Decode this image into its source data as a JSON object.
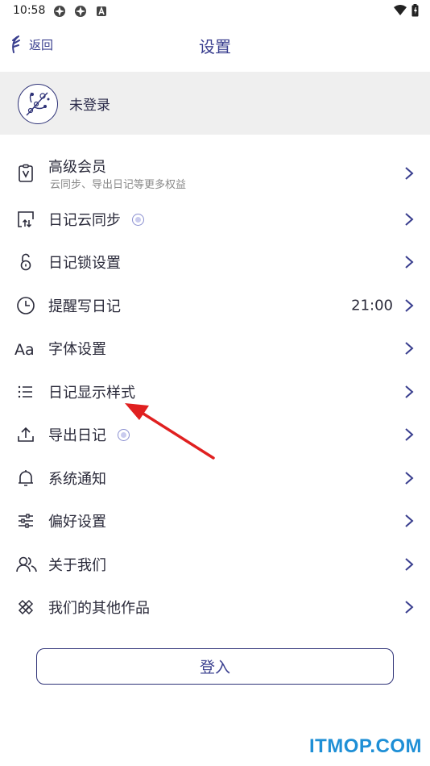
{
  "status_bar": {
    "time": "10:58"
  },
  "header": {
    "back_label": "返回",
    "title": "设置"
  },
  "account": {
    "label": "未登录"
  },
  "menu": [
    {
      "icon": "vip-clipboard-icon",
      "label": "高级会员",
      "sub": "云同步、导出日记等更多权益"
    },
    {
      "icon": "cloud-sync-icon",
      "label": "日记云同步",
      "badge": true
    },
    {
      "icon": "lock-icon",
      "label": "日记锁设置"
    },
    {
      "icon": "clock-icon",
      "label": "提醒写日记",
      "value": "21:00"
    },
    {
      "icon": "font-icon",
      "label": "字体设置"
    },
    {
      "icon": "list-icon",
      "label": "日记显示样式"
    },
    {
      "icon": "export-icon",
      "label": "导出日记",
      "badge": true
    },
    {
      "icon": "bell-icon",
      "label": "系统通知"
    },
    {
      "icon": "sliders-icon",
      "label": "偏好设置"
    },
    {
      "icon": "users-icon",
      "label": "关于我们"
    },
    {
      "icon": "apps-icon",
      "label": "我们的其他作品"
    }
  ],
  "login_button": "登入",
  "watermark": "ITMOP.COM",
  "colors": {
    "accent": "#3a3f8f",
    "annotation_arrow": "#e02020",
    "watermark": "#1e8fd6"
  }
}
